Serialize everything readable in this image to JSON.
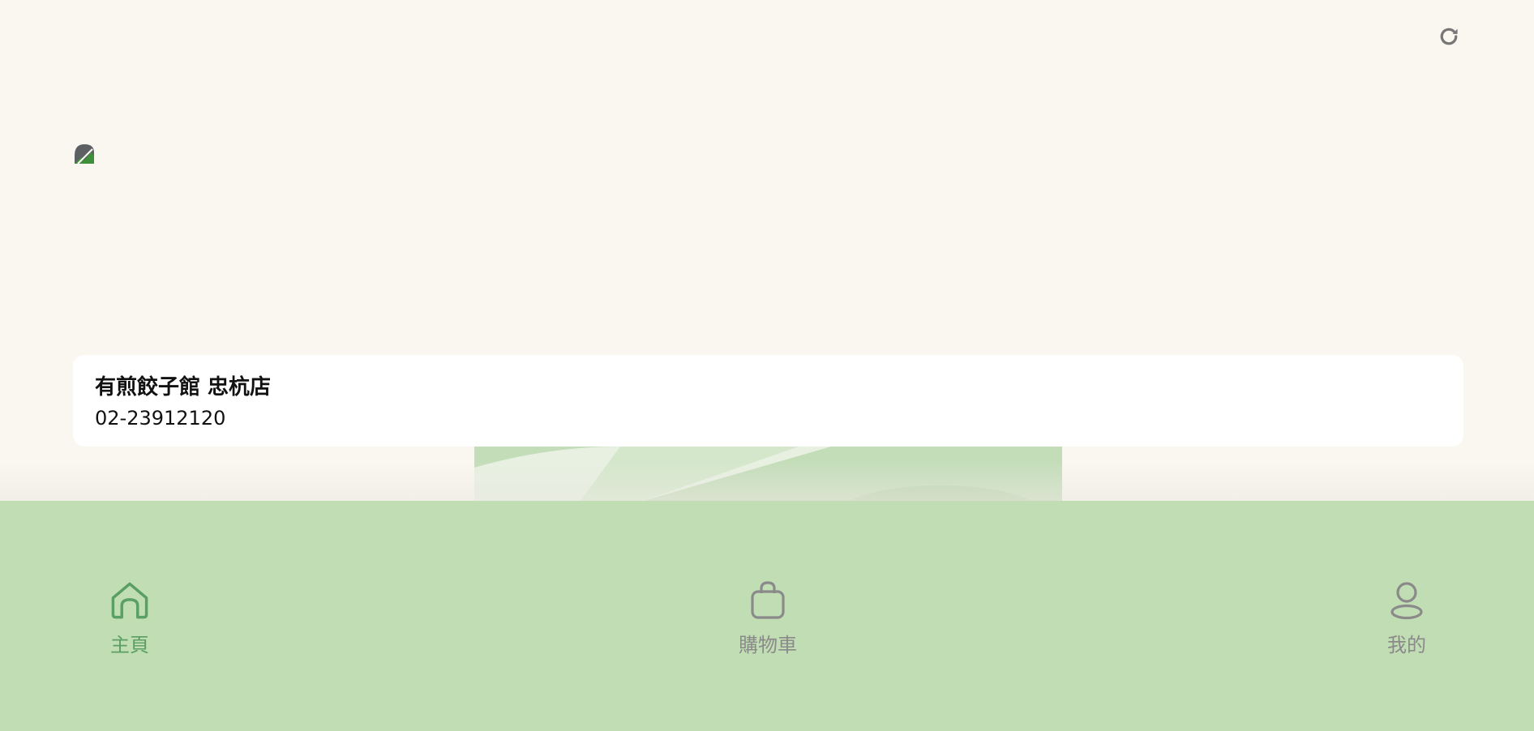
{
  "store": {
    "name": "有煎餃子館 忠杭店",
    "phone": "02-23912120"
  },
  "icons": {
    "refresh": "refresh-icon",
    "logo": "broken-image-icon",
    "home": "home-icon",
    "cart": "shopping-bag-icon",
    "profile": "user-icon"
  },
  "nav": {
    "home_label": "主頁",
    "cart_label": "購物車",
    "me_label": "我的"
  },
  "colors": {
    "background": "#faf7f0",
    "nav_background": "#c1ddb4",
    "active": "#5a9f63",
    "inactive": "#8a8a8a"
  }
}
